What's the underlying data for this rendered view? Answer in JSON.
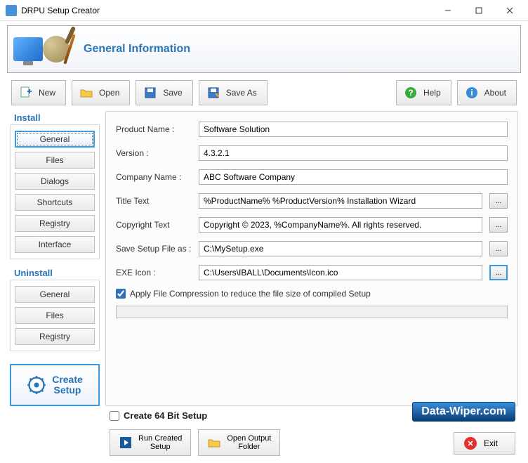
{
  "window": {
    "title": "DRPU Setup Creator"
  },
  "banner": {
    "heading": "General Information"
  },
  "toolbar": {
    "new": "New",
    "open": "Open",
    "save": "Save",
    "saveas": "Save As",
    "help": "Help",
    "about": "About"
  },
  "sidebar": {
    "install_label": "Install",
    "install_items": [
      "General",
      "Files",
      "Dialogs",
      "Shortcuts",
      "Registry",
      "Interface"
    ],
    "install_selected": 0,
    "uninstall_label": "Uninstall",
    "uninstall_items": [
      "General",
      "Files",
      "Registry"
    ],
    "create_label_line1": "Create",
    "create_label_line2": "Setup"
  },
  "form": {
    "product_name_label": "Product Name :",
    "product_name_value": "Software Solution",
    "version_label": "Version :",
    "version_value": "4.3.2.1",
    "company_label": "Company Name :",
    "company_value": "ABC Software Company",
    "title_label": "Title Text",
    "title_value": "%ProductName% %ProductVersion% Installation Wizard",
    "copyright_label": "Copyright Text",
    "copyright_value": "Copyright © 2023, %CompanyName%. All rights reserved.",
    "save_setup_label": "Save Setup File as :",
    "save_setup_value": "C:\\MySetup.exe",
    "exe_icon_label": "EXE Icon :",
    "exe_icon_value": "C:\\Users\\IBALL\\Documents\\Icon.ico",
    "browse_label": "...",
    "compress_label": "Apply File Compression to reduce the file size of compiled Setup",
    "compress_checked": true
  },
  "bottom": {
    "create64_label": "Create 64 Bit Setup",
    "create64_checked": false,
    "run_label": "Run Created\nSetup",
    "openout_label": "Open Output\nFolder",
    "exit_label": "Exit",
    "brand": "Data-Wiper.com"
  }
}
